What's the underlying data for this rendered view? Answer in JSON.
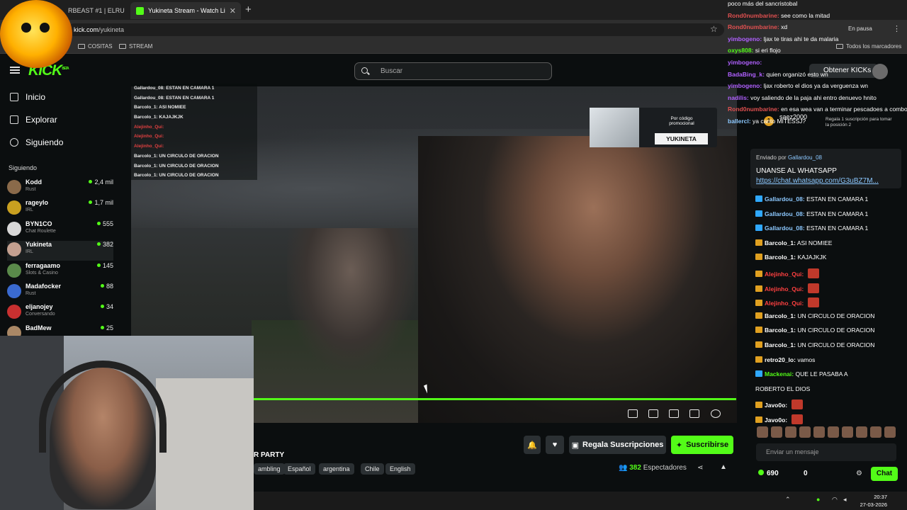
{
  "browser": {
    "tabs": [
      {
        "label": "RBEAST #1 | ELRU",
        "active": false
      },
      {
        "label": "Yukineta Stream - Watch Li",
        "active": true
      }
    ],
    "url_host": "kick.com",
    "url_path": "/yukineta",
    "bookmarks": [
      "COSITAS",
      "STREAM"
    ],
    "all_bookmarks": "Todos los marcadores",
    "paused_label": "En pausa"
  },
  "header": {
    "logo": "KICK",
    "logo_beta": "BETA",
    "search_placeholder": "Buscar",
    "kicks_button": "Obtener KICKs"
  },
  "sidebar": {
    "nav": [
      "Inicio",
      "Explorar",
      "Siguiendo"
    ],
    "section_title": "Siguiendo",
    "following": [
      {
        "name": "Kodd",
        "category": "Rust",
        "viewers": "2,4 mil",
        "color": "#8a6a4a"
      },
      {
        "name": "rageylo",
        "category": "IRL",
        "viewers": "1,7 mil",
        "color": "#c9a020"
      },
      {
        "name": "BYN1CO",
        "category": "Chat Roulette",
        "viewers": "555",
        "color": "#d8d8d8"
      },
      {
        "name": "Yukineta",
        "category": "IRL",
        "viewers": "382",
        "color": "#c4a090"
      },
      {
        "name": "ferragaamo",
        "category": "Slots & Casino",
        "viewers": "145",
        "color": "#5a8a4a"
      },
      {
        "name": "Madafocker",
        "category": "Rust",
        "viewers": "88",
        "color": "#3a6ad0"
      },
      {
        "name": "eljanojey",
        "category": "Conversando",
        "viewers": "34",
        "color": "#c83030"
      },
      {
        "name": "BadMew",
        "category": "",
        "viewers": "25",
        "color": "#aa8866"
      }
    ]
  },
  "overlay_chat": [
    {
      "text": "Gallardou_08: ESTAN EN CAMARA 1",
      "red": false
    },
    {
      "text": "Gallardou_08: ESTAN EN CAMARA 1",
      "red": false
    },
    {
      "text": "Barcolo_1: ASI NOMIEE",
      "red": false
    },
    {
      "text": "Barcolo_1: KAJAJKJK",
      "red": false
    },
    {
      "text": "Alejinho_Qui:",
      "red": true
    },
    {
      "text": "Alejinho_Qui:",
      "red": true
    },
    {
      "text": "Alejinho_Qui:",
      "red": true
    },
    {
      "text": "Barcolo_1: UN CIRCULO DE ORACION",
      "red": false
    },
    {
      "text": "Barcolo_1: UN CIRCULO DE ORACION",
      "red": false
    },
    {
      "text": "Barcolo_1: UN CIRCULO DE ORACION",
      "red": false
    }
  ],
  "promo": {
    "text": "Por código promocional",
    "code": "YUKINETA"
  },
  "stream": {
    "title": "R PARTY",
    "tags": [
      "ambling",
      "Español",
      "argentina",
      "Chile",
      "English"
    ],
    "viewers": "382",
    "viewers_label": "Espectadores",
    "gift_button": "Regala Suscripciones",
    "subscribe_button": "Suscribirse"
  },
  "chat_top": [
    {
      "user": "",
      "text": "poco más del sancristobal",
      "color": "#ffffff"
    },
    {
      "user": "Rond0numbarine:",
      "text": "see como la mitad",
      "color": "#e05050"
    },
    {
      "user": "Rond0numbarine:",
      "text": "xd",
      "color": "#e05050"
    },
    {
      "user": "yimbogeno:",
      "text": "ljax te tiras ahi te da malaria",
      "color": "#b060ff"
    },
    {
      "user": "oxys808:",
      "text": "si eri flojo",
      "color": "#53fc18"
    },
    {
      "user": "yimbogeno:",
      "text": "",
      "color": "#b060ff"
    },
    {
      "user": "BadaBing_k:",
      "text": "quien organizó esto wn",
      "color": "#b060ff"
    },
    {
      "user": "yimbogeno:",
      "text": "ljax roberto el dios ya da verguenza wn",
      "color": "#b060ff"
    },
    {
      "user": "nadilis:",
      "text": "voy saliendo de la paja ahi entro denuevo hnito",
      "color": "#b060ff"
    },
    {
      "user": "Rond0numbarine:",
      "text": "en esa wea van a terminar pescadoes a combos",
      "color": "#e05050"
    },
    {
      "user": "ballercl:",
      "text": "ya canto MITESSJ?",
      "color": "#8cc8ff"
    }
  ],
  "top_gifter": {
    "rank": "1",
    "name": "saez2000",
    "note": "Regala 1 suscripción para tomar la posición 2"
  },
  "pinned": {
    "sent_by_label": "Enviado por",
    "sent_by_user": "Gallardou_08",
    "message": "UNANSE AL WHATSAPP",
    "link": "https://chat.whatsapp.com/G3uBZ7M..."
  },
  "chat": [
    {
      "user": "Gallardou_08:",
      "text": "ESTAN EN CAMARA 1",
      "color": "#8cc8ff",
      "emotes": 0
    },
    {
      "user": "Gallardou_08:",
      "text": "ESTAN EN CAMARA 1",
      "color": "#8cc8ff",
      "emotes": 0
    },
    {
      "user": "Gallardou_08:",
      "text": "ESTAN EN CAMARA 1",
      "color": "#8cc8ff",
      "emotes": 0
    },
    {
      "user": "Barcolo_1:",
      "text": "ASI NOMIEE",
      "color": "#ffffff",
      "emotes": 0
    },
    {
      "user": "Barcolo_1:",
      "text": "KAJAJKJK",
      "color": "#ffffff",
      "emotes": 0
    },
    {
      "user": "Alejinho_Qui:",
      "text": "",
      "color": "#ff4040",
      "emotes": 1
    },
    {
      "user": "Alejinho_Qui:",
      "text": "",
      "color": "#ff4040",
      "emotes": 1
    },
    {
      "user": "Alejinho_Qui:",
      "text": "",
      "color": "#ff4040",
      "emotes": 1
    },
    {
      "user": "Barcolo_1:",
      "text": "UN CIRCULO DE ORACION",
      "color": "#ffffff",
      "emotes": 0
    },
    {
      "user": "Barcolo_1:",
      "text": "UN CIRCULO DE ORACION",
      "color": "#ffffff",
      "emotes": 0
    },
    {
      "user": "Barcolo_1:",
      "text": "UN CIRCULO DE ORACION",
      "color": "#ffffff",
      "emotes": 0
    },
    {
      "user": "retro20_lo:",
      "text": "vamos",
      "color": "#ffffff",
      "emotes": 0
    },
    {
      "user": "Mackenai:",
      "text": "QUE LE PASABA A",
      "color": "#53fc18",
      "emotes": 0
    },
    {
      "user": "",
      "text": "ROBERTO EL DIOS",
      "color": "#ffffff",
      "emotes": 0
    },
    {
      "user": "Javo0o:",
      "text": "",
      "color": "#ffffff",
      "emotes": 1
    },
    {
      "user": "Javo0o:",
      "text": "",
      "color": "#ffffff",
      "emotes": 1
    }
  ],
  "chat_input": {
    "placeholder": "Enviar un mensaje",
    "points": "690",
    "count": "0",
    "send_button": "Chat"
  },
  "taskbar": {
    "time": "20:37",
    "date": "27-03-2026"
  }
}
